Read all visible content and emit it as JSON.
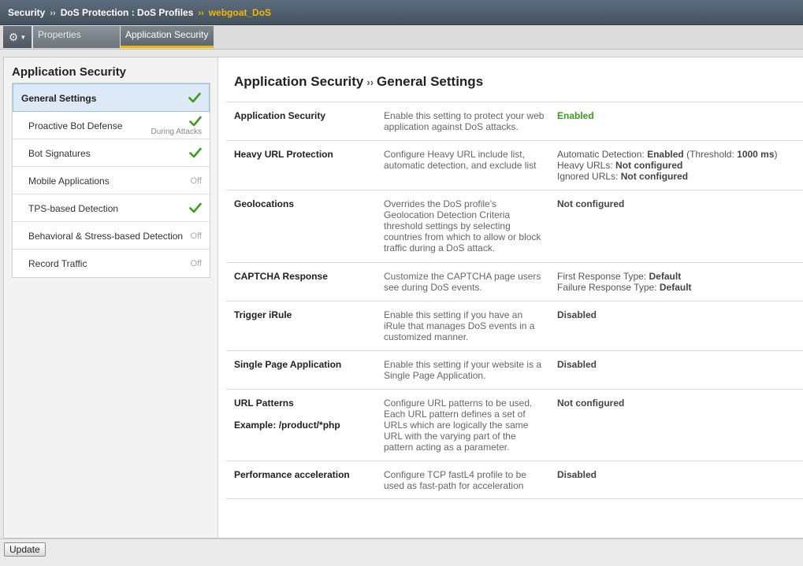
{
  "breadcrumb": {
    "part1": "Security",
    "sep1": "››",
    "part2": "DoS Protection : DoS Profiles",
    "sep2": "››",
    "current": "webgoat_DoS"
  },
  "tabs": {
    "gear_icon": "gear-icon",
    "properties": "Properties",
    "app_security": "Application Security"
  },
  "sidebar": {
    "title": "Application Security",
    "items": [
      {
        "label": "General Settings",
        "status": "check"
      },
      {
        "label": "Proactive Bot Defense",
        "status": "check",
        "sub": "During Attacks"
      },
      {
        "label": "Bot Signatures",
        "status": "check"
      },
      {
        "label": "Mobile Applications",
        "status": "Off"
      },
      {
        "label": "TPS-based Detection",
        "status": "check"
      },
      {
        "label": "Behavioral & Stress-based Detection",
        "status": "Off"
      },
      {
        "label": "Record Traffic",
        "status": "Off"
      }
    ]
  },
  "main": {
    "title": "Application Security",
    "title_sep": "››",
    "subtitle": "General Settings",
    "rows": [
      {
        "name": "Application Security",
        "desc": "Enable this setting to protect your web application against DoS attacks.",
        "value": "Enabled"
      },
      {
        "name": "Heavy URL Protection",
        "desc": "Configure Heavy URL include list, automatic detection, and exclude list",
        "value_auto_label": "Automatic Detection:",
        "value_auto": "Enabled",
        "value_threshold_open": "(Threshold:",
        "value_threshold": "1000 ms",
        "value_threshold_close": ")",
        "value_heavy_label": "Heavy URLs:",
        "value_heavy": "Not configured",
        "value_ignored_label": "Ignored URLs:",
        "value_ignored": "Not configured"
      },
      {
        "name": "Geolocations",
        "desc": "Overrides the DoS profile's Geolocation Detection Criteria threshold settings by selecting countries from which to allow or block traffic during a DoS attack.",
        "value": "Not configured"
      },
      {
        "name": "CAPTCHA Response",
        "desc": "Customize the CAPTCHA page users see during DoS events.",
        "value_first_label": "First Response Type:",
        "value_first": "Default",
        "value_failure_label": "Failure Response Type:",
        "value_failure": "Default"
      },
      {
        "name": "Trigger iRule",
        "desc": "Enable this setting if you have an iRule that manages DoS events in a customized manner.",
        "value": "Disabled"
      },
      {
        "name": "Single Page Application",
        "desc": "Enable this setting if your website is a Single Page Application.",
        "value": "Disabled"
      },
      {
        "name": "URL Patterns",
        "example": "Example: /product/*php",
        "desc": "Configure URL patterns to be used. Each URL pattern defines a set of URLs which are logically the same URL with the varying part of the pattern acting as a parameter.",
        "value": "Not configured"
      },
      {
        "name": "Performance acceleration",
        "desc": "Configure TCP fastL4 profile to be used as fast-path for acceleration",
        "value": "Disabled"
      }
    ]
  },
  "footer": {
    "update_label": "Update"
  },
  "colors": {
    "accent": "#f5b800",
    "enabled": "#3a9e1a",
    "check": "#3a9e1a"
  }
}
